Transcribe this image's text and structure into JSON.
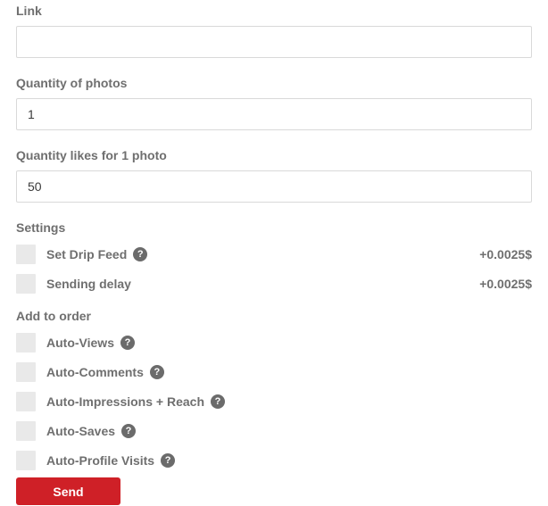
{
  "help_glyph": "?",
  "fields": [
    {
      "label": "Link",
      "value": ""
    },
    {
      "label": "Quantity of photos",
      "value": "1"
    },
    {
      "label": "Quantity likes for 1 photo",
      "value": "50"
    }
  ],
  "settings": {
    "heading": "Settings",
    "options": [
      {
        "label": "Set Drip Feed",
        "has_help": true,
        "price": "+0.0025$"
      },
      {
        "label": "Sending delay",
        "has_help": false,
        "price": "+0.0025$"
      }
    ]
  },
  "add_to_order": {
    "heading": "Add to order",
    "options": [
      {
        "label": "Auto-Views"
      },
      {
        "label": "Auto-Comments"
      },
      {
        "label": "Auto-Impressions + Reach"
      },
      {
        "label": "Auto-Saves"
      },
      {
        "label": "Auto-Profile Visits"
      }
    ]
  },
  "send_button": {
    "label": "Send"
  },
  "colors": {
    "accent_red": "#cf2027",
    "label_gray": "#6f6f6f",
    "checkbox_gray": "#e9e9e9",
    "input_border": "#d9d9d9"
  }
}
